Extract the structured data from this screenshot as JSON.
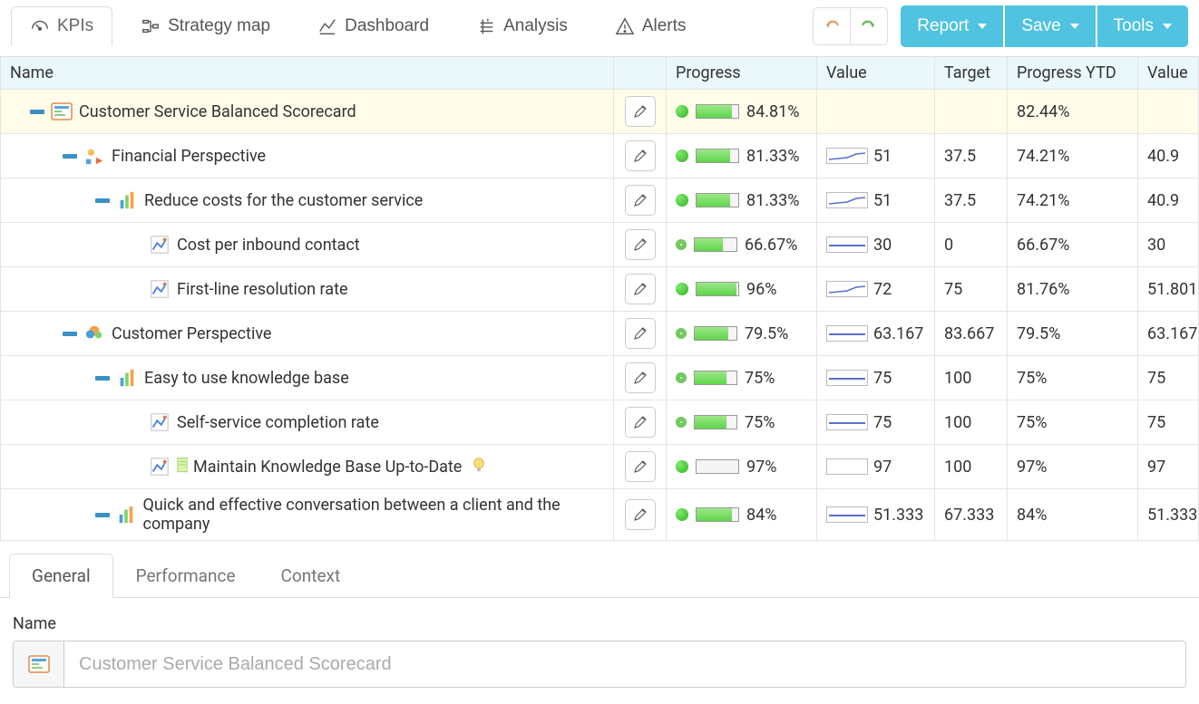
{
  "toolbar": {
    "tabs": [
      {
        "label": "KPIs"
      },
      {
        "label": "Strategy map"
      },
      {
        "label": "Dashboard"
      },
      {
        "label": "Analysis"
      },
      {
        "label": "Alerts"
      }
    ],
    "report": "Report",
    "save": "Save",
    "tools": "Tools"
  },
  "columns": {
    "name": "Name",
    "progress": "Progress",
    "value": "Value",
    "target": "Target",
    "progress_ytd": "Progress YTD",
    "value2": "Value"
  },
  "rows": [
    {
      "indent": 1,
      "expand": true,
      "icon": "scorecard",
      "name": "Customer Service Balanced Scorecard",
      "progress_pct": "84.81%",
      "progress_fill": 85,
      "value": "",
      "target": "",
      "ytd": "82.44%",
      "value2": "",
      "hl": true,
      "dot_empty": false
    },
    {
      "indent": 2,
      "expand": true,
      "icon": "perspective",
      "name": "Financial Perspective",
      "progress_pct": "81.33%",
      "progress_fill": 81,
      "value": "51",
      "spark": "line",
      "target": "37.5",
      "ytd": "74.21%",
      "value2": "40.9"
    },
    {
      "indent": 3,
      "expand": true,
      "icon": "goal",
      "name": "Reduce costs for the customer service",
      "progress_pct": "81.33%",
      "progress_fill": 81,
      "value": "51",
      "spark": "line",
      "target": "37.5",
      "ytd": "74.21%",
      "value2": "40.9"
    },
    {
      "indent": 4,
      "expand": false,
      "icon": "kpi",
      "name": "Cost per inbound contact",
      "progress_pct": "66.67%",
      "progress_fill": 67,
      "value": "30",
      "spark": "flat",
      "target": "0",
      "ytd": "66.67%",
      "value2": "30",
      "dot_empty": true
    },
    {
      "indent": 4,
      "expand": false,
      "icon": "kpi",
      "name": "First-line resolution rate",
      "progress_pct": "96%",
      "progress_fill": 96,
      "value": "72",
      "spark": "line",
      "target": "75",
      "ytd": "81.76%",
      "value2": "51.801"
    },
    {
      "indent": 2,
      "expand": true,
      "icon": "customer",
      "name": "Customer Perspective",
      "progress_pct": "79.5%",
      "progress_fill": 80,
      "value": "63.167",
      "spark": "flat",
      "target": "83.667",
      "ytd": "79.5%",
      "value2": "63.167",
      "dot_empty": true
    },
    {
      "indent": 3,
      "expand": true,
      "icon": "goal",
      "name": "Easy to use knowledge base",
      "progress_pct": "75%",
      "progress_fill": 75,
      "value": "75",
      "spark": "flat",
      "target": "100",
      "ytd": "75%",
      "value2": "75",
      "dot_empty": true
    },
    {
      "indent": 4,
      "expand": false,
      "icon": "kpi",
      "name": "Self-service completion rate",
      "progress_pct": "75%",
      "progress_fill": 75,
      "value": "75",
      "spark": "flat",
      "target": "100",
      "ytd": "75%",
      "value2": "75",
      "dot_empty": true
    },
    {
      "indent": 4,
      "expand": false,
      "icon": "kpi",
      "name": "Maintain Knowledge Base Up-to-Date",
      "extra_icons": true,
      "progress_pct": "97%",
      "progress_fill": 0,
      "value": "97",
      "spark": "empty",
      "target": "100",
      "ytd": "97%",
      "value2": "97",
      "bar_empty": true
    },
    {
      "indent": 3,
      "expand": true,
      "icon": "goal",
      "name": "Quick and effective conversation between a client and the company",
      "progress_pct": "84%",
      "progress_fill": 84,
      "value": "51.333",
      "spark": "flat",
      "target": "67.333",
      "ytd": "84%",
      "value2": "51.333"
    }
  ],
  "subtabs": {
    "general": "General",
    "performance": "Performance",
    "context": "Context"
  },
  "form": {
    "name_label": "Name",
    "name_value": "Customer Service Balanced Scorecard"
  }
}
